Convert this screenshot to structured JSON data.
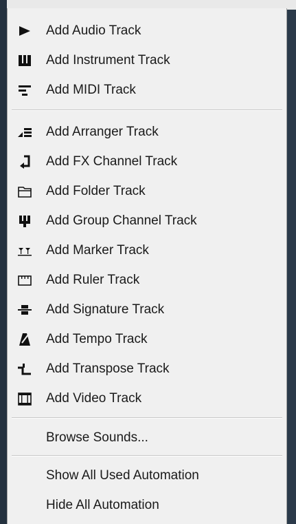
{
  "menu": {
    "items": [
      {
        "label": "Add Audio Track",
        "icon": "audio-track-icon"
      },
      {
        "label": "Add Instrument Track",
        "icon": "instrument-track-icon"
      },
      {
        "label": "Add MIDI Track",
        "icon": "midi-track-icon"
      },
      {
        "label": "Add Arranger Track",
        "icon": "arranger-track-icon"
      },
      {
        "label": "Add FX Channel Track",
        "icon": "fx-channel-track-icon"
      },
      {
        "label": "Add Folder Track",
        "icon": "folder-track-icon"
      },
      {
        "label": "Add Group Channel Track",
        "icon": "group-channel-track-icon"
      },
      {
        "label": "Add Marker Track",
        "icon": "marker-track-icon"
      },
      {
        "label": "Add Ruler Track",
        "icon": "ruler-track-icon"
      },
      {
        "label": "Add Signature Track",
        "icon": "signature-track-icon"
      },
      {
        "label": "Add Tempo Track",
        "icon": "tempo-track-icon"
      },
      {
        "label": "Add Transpose Track",
        "icon": "transpose-track-icon"
      },
      {
        "label": "Add Video Track",
        "icon": "video-track-icon"
      }
    ],
    "browse_label": "Browse Sounds...",
    "show_automation_label": "Show All Used Automation",
    "hide_automation_label": "Hide All Automation"
  }
}
